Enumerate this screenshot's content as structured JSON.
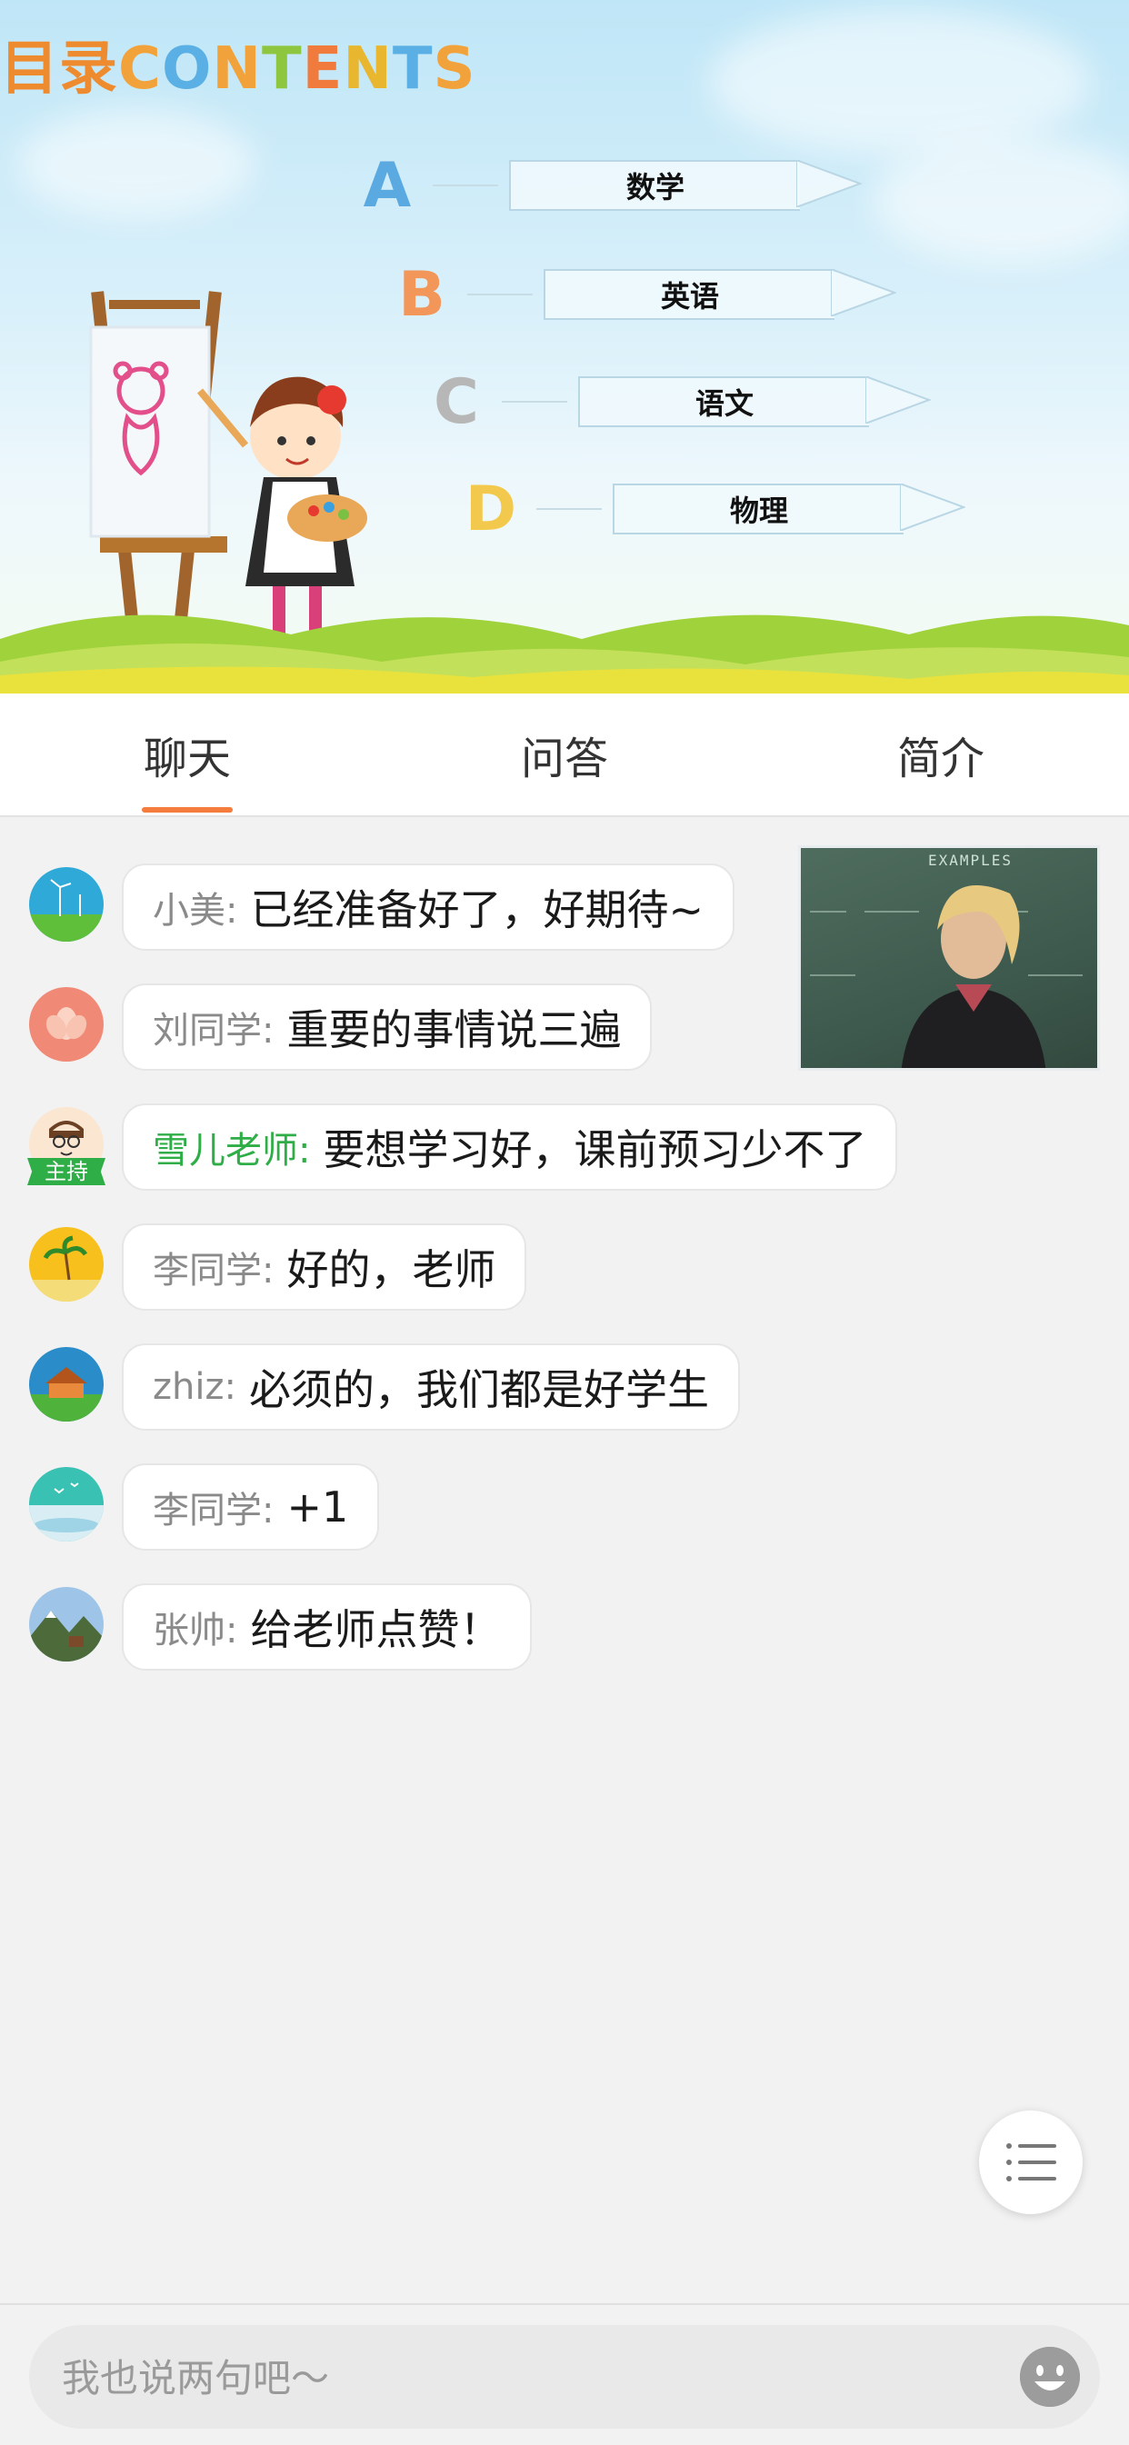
{
  "hero": {
    "title_cn": "目录",
    "title_en": [
      "C",
      "O",
      "N",
      "T",
      "E",
      "N",
      "T",
      "S"
    ],
    "menu": [
      {
        "letter": "A",
        "label": "数学",
        "color": "#5aa9e0"
      },
      {
        "letter": "B",
        "label": "英语",
        "color": "#f2965a"
      },
      {
        "letter": "C",
        "label": "语文",
        "color": "#b7b7b7"
      },
      {
        "letter": "D",
        "label": "物理",
        "color": "#f2c94c"
      }
    ]
  },
  "tabs": [
    {
      "label": "聊天",
      "active": true
    },
    {
      "label": "问答",
      "active": false
    },
    {
      "label": "简介",
      "active": false
    }
  ],
  "accent_color": "#f47c3c",
  "host_color": "#2fae47",
  "messages": [
    {
      "name": "小美:",
      "text": "已经准备好了，好期待~",
      "avatar": "wind-turbine-avatar"
    },
    {
      "name": "刘同学:",
      "text": "重要的事情说三遍",
      "avatar": "flower-avatar"
    },
    {
      "name": "雪儿老师:",
      "text": "要想学习好，课前预习少不了",
      "avatar": "teacher-avatar",
      "host": true,
      "badge": "主持"
    },
    {
      "name": "李同学:",
      "text": "好的，老师",
      "avatar": "palm-tree-avatar"
    },
    {
      "name": "zhiz:",
      "text": "必须的，我们都是好学生",
      "avatar": "house-avatar"
    },
    {
      "name": "李同学:",
      "text": "+1",
      "avatar": "bird-sky-avatar"
    },
    {
      "name": "张帅:",
      "text": "给老师点赞！",
      "avatar": "mountain-avatar"
    }
  ],
  "video": {
    "board_text": "EXAMPLES"
  },
  "input": {
    "placeholder": "我也说两句吧～"
  }
}
